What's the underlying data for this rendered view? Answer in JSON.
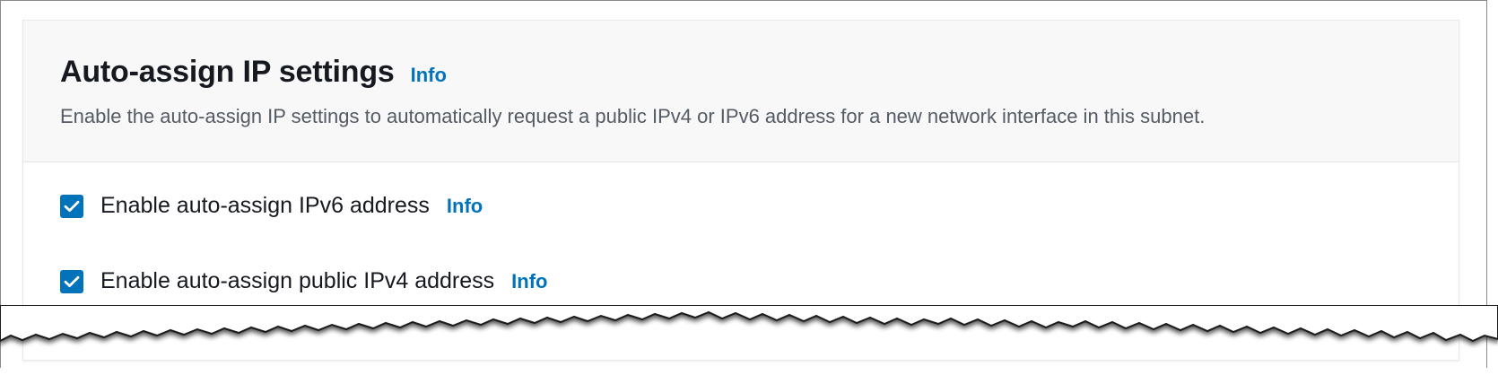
{
  "section": {
    "title": "Auto-assign IP settings",
    "title_info": "Info",
    "description": "Enable the auto-assign IP settings to automatically request a public IPv4 or IPv6 address for a new network interface in this subnet."
  },
  "options": [
    {
      "label": "Enable auto-assign IPv6 address",
      "info": "Info",
      "checked": true
    },
    {
      "label": "Enable auto-assign public IPv4 address",
      "info": "Info",
      "checked": true
    }
  ],
  "colors": {
    "accent": "#0073bb",
    "title": "#16191f",
    "description": "#545b64",
    "header_background": "#f8f8f8"
  },
  "icons": {
    "checkbox_mark": "checkmark-icon"
  }
}
